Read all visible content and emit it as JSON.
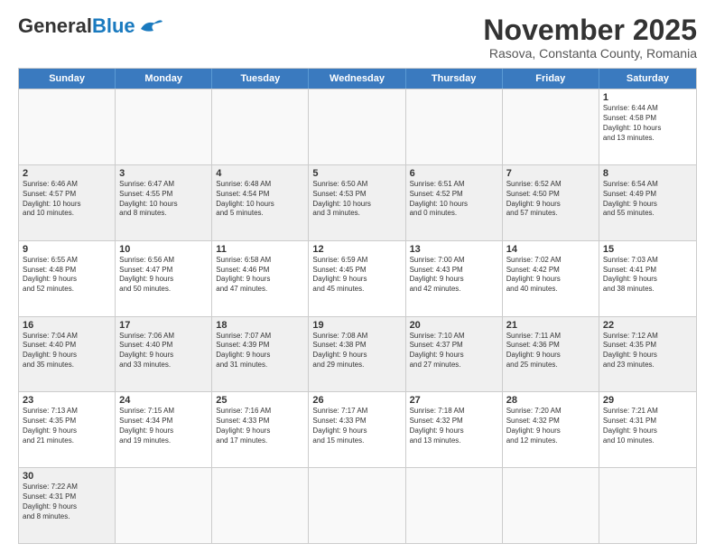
{
  "header": {
    "logo_general": "General",
    "logo_blue": "Blue",
    "month_title": "November 2025",
    "subtitle": "Rasova, Constanta County, Romania"
  },
  "days_of_week": [
    "Sunday",
    "Monday",
    "Tuesday",
    "Wednesday",
    "Thursday",
    "Friday",
    "Saturday"
  ],
  "weeks": [
    [
      {
        "day": "",
        "info": "",
        "empty": true
      },
      {
        "day": "",
        "info": "",
        "empty": true
      },
      {
        "day": "",
        "info": "",
        "empty": true
      },
      {
        "day": "",
        "info": "",
        "empty": true
      },
      {
        "day": "",
        "info": "",
        "empty": true
      },
      {
        "day": "",
        "info": "",
        "empty": true
      },
      {
        "day": "1",
        "info": "Sunrise: 6:44 AM\nSunset: 4:58 PM\nDaylight: 10 hours\nand 13 minutes."
      }
    ],
    [
      {
        "day": "2",
        "info": "Sunrise: 6:46 AM\nSunset: 4:57 PM\nDaylight: 10 hours\nand 10 minutes."
      },
      {
        "day": "3",
        "info": "Sunrise: 6:47 AM\nSunset: 4:55 PM\nDaylight: 10 hours\nand 8 minutes."
      },
      {
        "day": "4",
        "info": "Sunrise: 6:48 AM\nSunset: 4:54 PM\nDaylight: 10 hours\nand 5 minutes."
      },
      {
        "day": "5",
        "info": "Sunrise: 6:50 AM\nSunset: 4:53 PM\nDaylight: 10 hours\nand 3 minutes."
      },
      {
        "day": "6",
        "info": "Sunrise: 6:51 AM\nSunset: 4:52 PM\nDaylight: 10 hours\nand 0 minutes."
      },
      {
        "day": "7",
        "info": "Sunrise: 6:52 AM\nSunset: 4:50 PM\nDaylight: 9 hours\nand 57 minutes."
      },
      {
        "day": "8",
        "info": "Sunrise: 6:54 AM\nSunset: 4:49 PM\nDaylight: 9 hours\nand 55 minutes."
      }
    ],
    [
      {
        "day": "9",
        "info": "Sunrise: 6:55 AM\nSunset: 4:48 PM\nDaylight: 9 hours\nand 52 minutes."
      },
      {
        "day": "10",
        "info": "Sunrise: 6:56 AM\nSunset: 4:47 PM\nDaylight: 9 hours\nand 50 minutes."
      },
      {
        "day": "11",
        "info": "Sunrise: 6:58 AM\nSunset: 4:46 PM\nDaylight: 9 hours\nand 47 minutes."
      },
      {
        "day": "12",
        "info": "Sunrise: 6:59 AM\nSunset: 4:45 PM\nDaylight: 9 hours\nand 45 minutes."
      },
      {
        "day": "13",
        "info": "Sunrise: 7:00 AM\nSunset: 4:43 PM\nDaylight: 9 hours\nand 42 minutes."
      },
      {
        "day": "14",
        "info": "Sunrise: 7:02 AM\nSunset: 4:42 PM\nDaylight: 9 hours\nand 40 minutes."
      },
      {
        "day": "15",
        "info": "Sunrise: 7:03 AM\nSunset: 4:41 PM\nDaylight: 9 hours\nand 38 minutes."
      }
    ],
    [
      {
        "day": "16",
        "info": "Sunrise: 7:04 AM\nSunset: 4:40 PM\nDaylight: 9 hours\nand 35 minutes."
      },
      {
        "day": "17",
        "info": "Sunrise: 7:06 AM\nSunset: 4:40 PM\nDaylight: 9 hours\nand 33 minutes."
      },
      {
        "day": "18",
        "info": "Sunrise: 7:07 AM\nSunset: 4:39 PM\nDaylight: 9 hours\nand 31 minutes."
      },
      {
        "day": "19",
        "info": "Sunrise: 7:08 AM\nSunset: 4:38 PM\nDaylight: 9 hours\nand 29 minutes."
      },
      {
        "day": "20",
        "info": "Sunrise: 7:10 AM\nSunset: 4:37 PM\nDaylight: 9 hours\nand 27 minutes."
      },
      {
        "day": "21",
        "info": "Sunrise: 7:11 AM\nSunset: 4:36 PM\nDaylight: 9 hours\nand 25 minutes."
      },
      {
        "day": "22",
        "info": "Sunrise: 7:12 AM\nSunset: 4:35 PM\nDaylight: 9 hours\nand 23 minutes."
      }
    ],
    [
      {
        "day": "23",
        "info": "Sunrise: 7:13 AM\nSunset: 4:35 PM\nDaylight: 9 hours\nand 21 minutes."
      },
      {
        "day": "24",
        "info": "Sunrise: 7:15 AM\nSunset: 4:34 PM\nDaylight: 9 hours\nand 19 minutes."
      },
      {
        "day": "25",
        "info": "Sunrise: 7:16 AM\nSunset: 4:33 PM\nDaylight: 9 hours\nand 17 minutes."
      },
      {
        "day": "26",
        "info": "Sunrise: 7:17 AM\nSunset: 4:33 PM\nDaylight: 9 hours\nand 15 minutes."
      },
      {
        "day": "27",
        "info": "Sunrise: 7:18 AM\nSunset: 4:32 PM\nDaylight: 9 hours\nand 13 minutes."
      },
      {
        "day": "28",
        "info": "Sunrise: 7:20 AM\nSunset: 4:32 PM\nDaylight: 9 hours\nand 12 minutes."
      },
      {
        "day": "29",
        "info": "Sunrise: 7:21 AM\nSunset: 4:31 PM\nDaylight: 9 hours\nand 10 minutes."
      }
    ],
    [
      {
        "day": "30",
        "info": "Sunrise: 7:22 AM\nSunset: 4:31 PM\nDaylight: 9 hours\nand 8 minutes."
      },
      {
        "day": "",
        "info": "",
        "empty": true
      },
      {
        "day": "",
        "info": "",
        "empty": true
      },
      {
        "day": "",
        "info": "",
        "empty": true
      },
      {
        "day": "",
        "info": "",
        "empty": true
      },
      {
        "day": "",
        "info": "",
        "empty": true
      },
      {
        "day": "",
        "info": "",
        "empty": true
      }
    ]
  ]
}
